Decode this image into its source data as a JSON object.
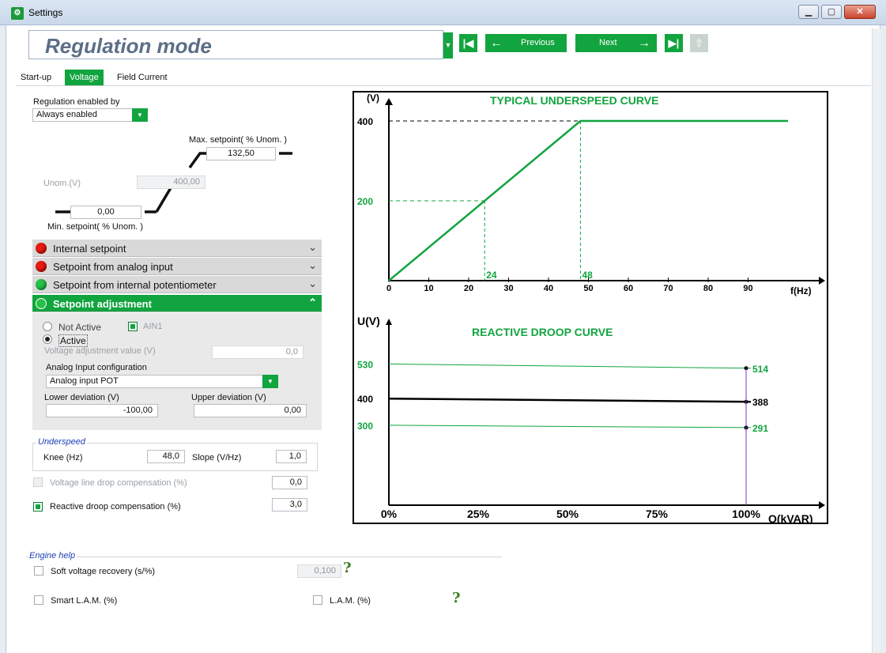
{
  "window": {
    "title": "Settings"
  },
  "header": {
    "mode_title": "Regulation mode",
    "prev_label": "Previous",
    "next_label": "Next"
  },
  "tabs": [
    {
      "label": "Start-up",
      "active": false
    },
    {
      "label": "Voltage",
      "active": true
    },
    {
      "label": "Field Current",
      "active": false
    }
  ],
  "regulation": {
    "enabled_by_label": "Regulation enabled by",
    "enabled_by_value": "Always enabled",
    "max_setpoint_label": "Max. setpoint( % Unom. )",
    "max_setpoint_value": "132,50",
    "unom_label": "Unom.(V)",
    "unom_value": "400,00",
    "min_setpoint_value": "0,00",
    "min_setpoint_label": "Min. setpoint( % Unom. )"
  },
  "accordion": [
    {
      "label": "Internal setpoint",
      "status_color": "#e81b13",
      "open": false
    },
    {
      "label": "Setpoint from analog input",
      "status_color": "#e81b13",
      "open": false
    },
    {
      "label": "Setpoint from internal potentiometer",
      "status_color": "#27c24a",
      "open": false
    },
    {
      "label": "Setpoint adjustment",
      "status_color": "#27c24a",
      "open": true
    }
  ],
  "adjustment": {
    "not_active_label": "Not Active",
    "ain_label": "AIN1",
    "active_label": "Active",
    "selected": "Active",
    "voltage_adj_label": "Voltage adjustment value (V)",
    "voltage_adj_value": "0,0",
    "analog_config_label": "Analog Input configuration",
    "analog_config_value": "Analog input POT",
    "lower_dev_label": "Lower deviation (V)",
    "lower_dev_value": "-100,00",
    "upper_dev_label": "Upper deviation (V)",
    "upper_dev_value": "0,00"
  },
  "underspeed": {
    "legend": "Underspeed",
    "knee_label": "Knee (Hz)",
    "knee_value": "48,0",
    "slope_label": "Slope (V/Hz)",
    "slope_value": "1,0"
  },
  "compensation": {
    "line_drop_label": "Voltage line drop compensation (%)",
    "line_drop_value": "0,0",
    "line_drop_checked": false,
    "reactive_droop_label": "Reactive droop compensation (%)",
    "reactive_droop_value": "3,0",
    "reactive_droop_checked": true
  },
  "engine_help": {
    "legend": "Engine help",
    "soft_recovery_label": "Soft voltage recovery  (s/%)",
    "soft_recovery_value": "0,100",
    "smart_lam_label": "Smart L.A.M.  (%)",
    "lam_label": "L.A.M. (%)",
    "help_symbol": "?"
  },
  "chart_data": [
    {
      "type": "line",
      "title": "TYPICAL UNDERSPEED CURVE",
      "xlabel": "f(Hz)",
      "ylabel": "(V)",
      "x_ticks": [
        "0",
        "10",
        "20",
        "30",
        "40",
        "50",
        "60",
        "70",
        "80",
        "90"
      ],
      "y_ticks": [
        "200",
        "400"
      ],
      "xlim": [
        0,
        100
      ],
      "ylim": [
        0,
        450
      ],
      "series": [
        {
          "x": [
            0,
            48,
            100
          ],
          "y": [
            0,
            400,
            400
          ]
        }
      ],
      "annotations": [
        {
          "x": 24,
          "y": 200,
          "label": "24"
        },
        {
          "x": 48,
          "y": 400,
          "label": "48"
        }
      ],
      "color": "#12a43f"
    },
    {
      "type": "line",
      "title": "REACTIVE DROOP CURVE",
      "xlabel": "Q(kVAR)",
      "ylabel": "U(V)",
      "x_ticks": [
        "0%",
        "25%",
        "50%",
        "75%",
        "100%"
      ],
      "xlim": [
        0,
        100
      ],
      "ylim": [
        0,
        700
      ],
      "series": [
        {
          "x": [
            0,
            100
          ],
          "y": [
            530,
            514
          ],
          "color": "#12a43f"
        },
        {
          "x": [
            0,
            100
          ],
          "y": [
            400,
            388
          ],
          "color": "#000000"
        },
        {
          "x": [
            0,
            100
          ],
          "y": [
            300,
            291
          ],
          "color": "#12a43f"
        }
      ],
      "left_labels": [
        "530",
        "400",
        "300"
      ],
      "right_labels": [
        "514",
        "388",
        "291"
      ]
    }
  ]
}
